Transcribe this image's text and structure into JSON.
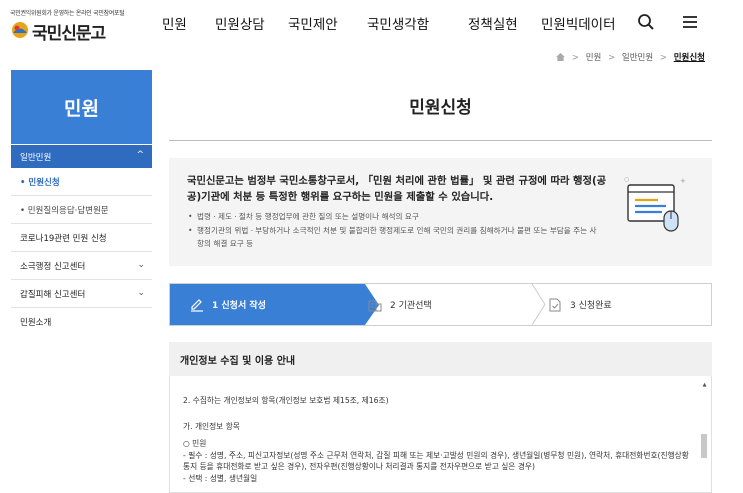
{
  "header": {
    "logo_tagline": "국민권익위원회가 운영하는 온라인 국민참여포털",
    "logo_name": "국민신문고",
    "nav": [
      "민원",
      "민원상담",
      "국민제안",
      "국민생각함",
      "정책실현",
      "민원빅데이터"
    ],
    "icons": [
      "search-icon",
      "menu-icon"
    ]
  },
  "breadcrumb": {
    "items": [
      "민원",
      "일반민원"
    ],
    "current": "민원신청",
    "home_icon": "home-icon"
  },
  "sidebar": {
    "title": "민원",
    "group": "일반민원",
    "subitems": [
      {
        "label": "• 민원신청",
        "active": true
      },
      {
        "label": "• 민원질의응답·답변원문",
        "active": false
      }
    ],
    "items": [
      {
        "label": "코로나19관련 민원 신청",
        "expandable": false
      },
      {
        "label": "소극행정 신고센터",
        "expandable": true
      },
      {
        "label": "갑질피해 신고센터",
        "expandable": true
      },
      {
        "label": "민원소개",
        "expandable": false
      }
    ]
  },
  "main": {
    "title": "민원신청",
    "intro_lead": "국민신문고는 범정부 국민소통창구로서, 「민원 처리에 관한 법률」 및 관련 규정에 따라 행정(공공)기관에 처분 등 특정한 행위를 요구하는 민원을 제출할 수 있습니다.",
    "intro_bullets": [
      "법령ㆍ제도ㆍ절차 등 행정업무에 관한 질의 또는 설명이나 해석의 요구",
      "행정기관의 위법ㆍ부당하거나 소극적인 처분 및 불합리한 행정제도로 인해 국민의 권리를 침해하거나 불편 또는 부담을 주는 사항의 해결 요구 등"
    ],
    "steps": [
      "1 신청서 작성",
      "2 기관선택",
      "3 신청완료"
    ],
    "privacy_title": "개인정보 수집 및 이용 안내",
    "privacy_lines": {
      "heading": "2. 수집하는 개인정보의 항목(개인정보 보호법 제15조, 제16조)",
      "sub": "가. 개인정보 항목",
      "item": "○ 민원",
      "required": "- 필수 : 성명, 주소, 피신고자정보(성명 주소 근무처 연락처, 갑질 피해 또는 제보·고발성 민원의 경우), 생년월일(병무청 민원), 연락처, 휴대전화번호(진행상황 통지 등을 휴대전화로 받고 싶은 경우), 전자우편(진행상황이나 처리결과 통지를 전자우편으로 받고 싶은 경우)",
      "optional": "- 선택 : 성별, 생년월일"
    }
  },
  "colors": {
    "primary": "#3a7fd6",
    "primary_dark": "#2f6cc0",
    "intro_bg": "#f4f4f4"
  }
}
